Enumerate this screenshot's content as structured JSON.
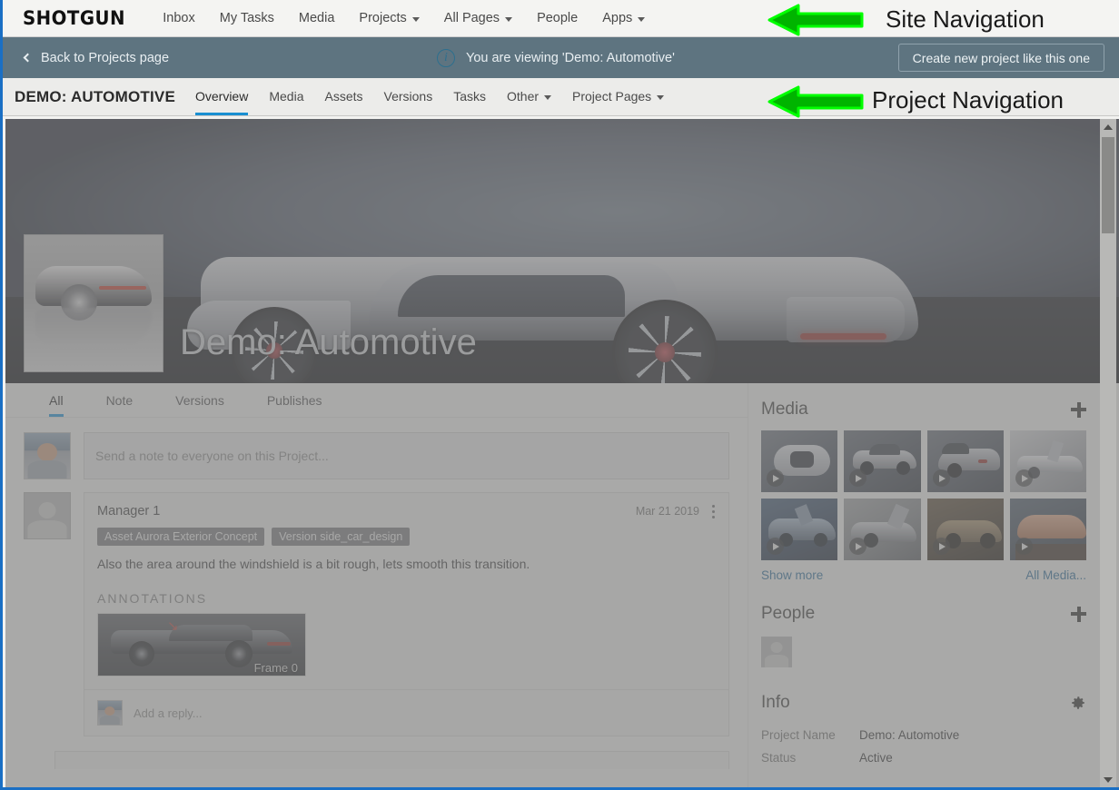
{
  "site_nav": {
    "logo": "SHOTGUN",
    "items": [
      {
        "label": "Inbox",
        "caret": false
      },
      {
        "label": "My Tasks",
        "caret": false
      },
      {
        "label": "Media",
        "caret": false
      },
      {
        "label": "Projects",
        "caret": true
      },
      {
        "label": "All Pages",
        "caret": true
      },
      {
        "label": "People",
        "caret": false
      },
      {
        "label": "Apps",
        "caret": true
      }
    ]
  },
  "viewing_bar": {
    "back_label": "Back to Projects page",
    "info_icon": "info-icon",
    "viewing_text": "You are viewing 'Demo: Automotive'",
    "create_button": "Create new project like this one"
  },
  "project_nav": {
    "title": "DEMO: AUTOMOTIVE",
    "items": [
      {
        "label": "Overview",
        "caret": false,
        "active": true
      },
      {
        "label": "Media",
        "caret": false,
        "active": false
      },
      {
        "label": "Assets",
        "caret": false,
        "active": false
      },
      {
        "label": "Versions",
        "caret": false,
        "active": false
      },
      {
        "label": "Tasks",
        "caret": false,
        "active": false
      },
      {
        "label": "Other",
        "caret": true,
        "active": false
      },
      {
        "label": "Project Pages",
        "caret": true,
        "active": false
      }
    ]
  },
  "hero": {
    "project_name": "Demo: Automotive",
    "thumbnail_alt": "project-thumbnail"
  },
  "feed": {
    "tabs": [
      {
        "label": "All",
        "active": true
      },
      {
        "label": "Note",
        "active": false
      },
      {
        "label": "Versions",
        "active": false
      },
      {
        "label": "Publishes",
        "active": false
      }
    ],
    "composer_placeholder": "Send a note to everyone on this Project...",
    "note": {
      "author": "Manager 1",
      "date": "Mar 21 2019",
      "chips": [
        "Asset Aurora Exterior Concept",
        "Version side_car_design"
      ],
      "body": "Also the area around the windshield is a bit rough, lets smooth this transition.",
      "annotations_label": "ANNOTATIONS",
      "frame_label": "Frame 0",
      "reply_placeholder": "Add a reply..."
    }
  },
  "sidebar": {
    "media": {
      "title": "Media",
      "add_icon": "plus-icon",
      "thumbnails": [
        {
          "name": "media-thumb-1",
          "has_play": true
        },
        {
          "name": "media-thumb-2",
          "has_play": true
        },
        {
          "name": "media-thumb-3",
          "has_play": true
        },
        {
          "name": "media-thumb-4",
          "has_play": true
        },
        {
          "name": "media-thumb-5",
          "has_play": true
        },
        {
          "name": "media-thumb-6",
          "has_play": true
        },
        {
          "name": "media-thumb-7",
          "has_play": true
        },
        {
          "name": "media-thumb-8",
          "has_play": true
        }
      ],
      "show_more": "Show more",
      "all_media": "All Media..."
    },
    "people": {
      "title": "People",
      "add_icon": "plus-icon"
    },
    "info": {
      "title": "Info",
      "settings_icon": "gear-icon",
      "rows": [
        {
          "key": "Project Name",
          "value": "Demo: Automotive"
        },
        {
          "key": "Status",
          "value": "Active"
        }
      ]
    }
  },
  "annotations": {
    "site_nav_callout": "Site Navigation",
    "project_nav_callout": "Project Navigation",
    "arrow_color": "#00b400",
    "arrow_outline": "#00ff00"
  }
}
